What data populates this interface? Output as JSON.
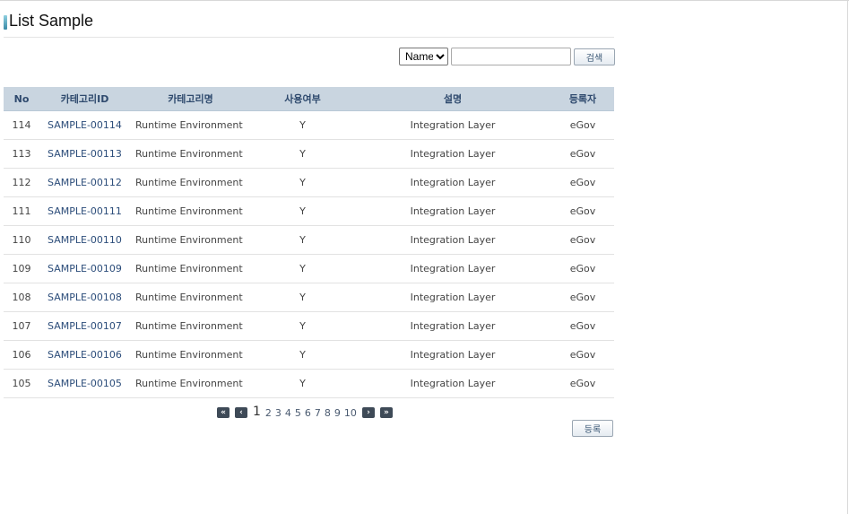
{
  "page": {
    "title": "List Sample"
  },
  "search": {
    "field_selected": "Name",
    "field_options": [
      "Name"
    ],
    "query_value": "",
    "button_label": "검색"
  },
  "table": {
    "headers": [
      "No",
      "카테고리ID",
      "카테고리명",
      "사용여부",
      "설명",
      "등록자"
    ],
    "rows": [
      {
        "no": "114",
        "id": "SAMPLE-00114",
        "name": "Runtime Environment",
        "use": "Y",
        "desc": "Integration Layer",
        "reg": "eGov"
      },
      {
        "no": "113",
        "id": "SAMPLE-00113",
        "name": "Runtime Environment",
        "use": "Y",
        "desc": "Integration Layer",
        "reg": "eGov"
      },
      {
        "no": "112",
        "id": "SAMPLE-00112",
        "name": "Runtime Environment",
        "use": "Y",
        "desc": "Integration Layer",
        "reg": "eGov"
      },
      {
        "no": "111",
        "id": "SAMPLE-00111",
        "name": "Runtime Environment",
        "use": "Y",
        "desc": "Integration Layer",
        "reg": "eGov"
      },
      {
        "no": "110",
        "id": "SAMPLE-00110",
        "name": "Runtime Environment",
        "use": "Y",
        "desc": "Integration Layer",
        "reg": "eGov"
      },
      {
        "no": "109",
        "id": "SAMPLE-00109",
        "name": "Runtime Environment",
        "use": "Y",
        "desc": "Integration Layer",
        "reg": "eGov"
      },
      {
        "no": "108",
        "id": "SAMPLE-00108",
        "name": "Runtime Environment",
        "use": "Y",
        "desc": "Integration Layer",
        "reg": "eGov"
      },
      {
        "no": "107",
        "id": "SAMPLE-00107",
        "name": "Runtime Environment",
        "use": "Y",
        "desc": "Integration Layer",
        "reg": "eGov"
      },
      {
        "no": "106",
        "id": "SAMPLE-00106",
        "name": "Runtime Environment",
        "use": "Y",
        "desc": "Integration Layer",
        "reg": "eGov"
      },
      {
        "no": "105",
        "id": "SAMPLE-00105",
        "name": "Runtime Environment",
        "use": "Y",
        "desc": "Integration Layer",
        "reg": "eGov"
      }
    ]
  },
  "pagination": {
    "first": "«",
    "prev": "‹",
    "next": "›",
    "last": "»",
    "current": "1",
    "pages": [
      "2",
      "3",
      "4",
      "5",
      "6",
      "7",
      "8",
      "9",
      "10"
    ]
  },
  "actions": {
    "register_label": "등록"
  },
  "colors": {
    "header_bg": "#c9d5e0",
    "header_text": "#2f4a6e",
    "link": "#2c4d7a",
    "pager_btn": "#3e4a57"
  },
  "icons": {
    "title_marker": "title-bar-icon"
  }
}
